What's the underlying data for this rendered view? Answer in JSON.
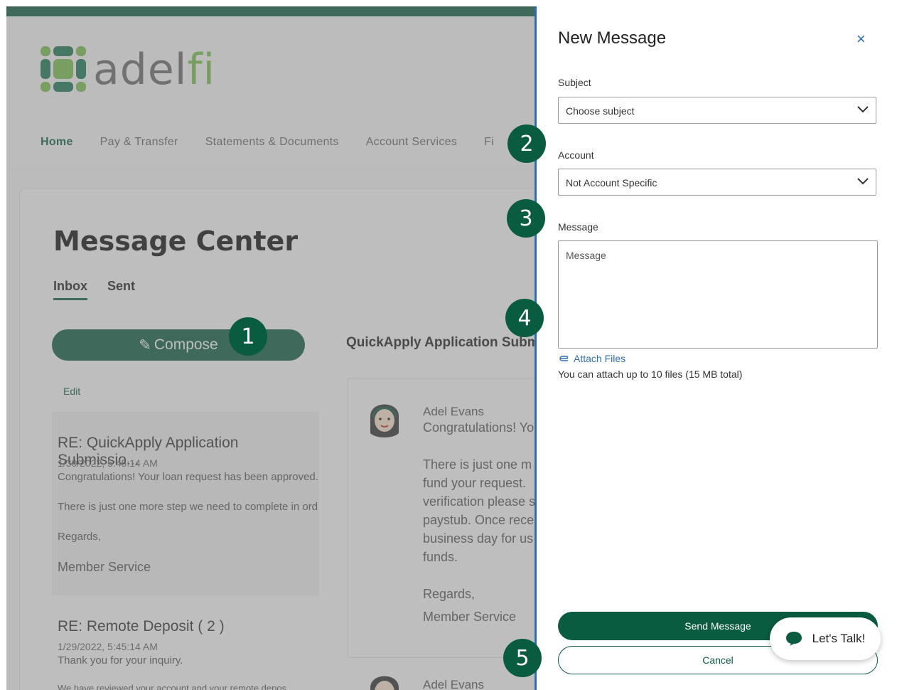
{
  "brand": {
    "logo_main": "adel",
    "logo_accent": "fi"
  },
  "nav": [
    "Home",
    "Pay & Transfer",
    "Statements & Documents",
    "Account Services",
    "Fi"
  ],
  "page": {
    "title": "Message Center",
    "tabs": [
      "Inbox",
      "Sent"
    ],
    "compose_label": "Compose",
    "edit_label": "Edit"
  },
  "messages": [
    {
      "subject": "RE: QuickApply Application Submissio...",
      "date": "1/30/2022, 5:45:14 AM",
      "lines": [
        "Congratulations! Your loan request has been approved.",
        "There is just one more step we need to complete in ord",
        "Regards,",
        "Member Service"
      ]
    },
    {
      "subject": "RE: Remote Deposit ( 2 )",
      "date": "1/29/2022, 5:45:14 AM",
      "lines": [
        "Thank you for your inquiry.",
        "We have reviewed your account and your remote depos"
      ]
    }
  ],
  "detail": {
    "title": "QuickApply Application Submi",
    "sender": "Adel Evans",
    "lines": [
      "Congratulations! Yo",
      "There is just one m",
      "fund your request.",
      "verification please s",
      "paystub. Once rece",
      "business day for us",
      "funds.",
      "Regards,",
      "Member Service"
    ],
    "sender2": "Adel Evans"
  },
  "drawer": {
    "title": "New Message",
    "close": "×",
    "subject_label": "Subject",
    "subject_value": "Choose subject",
    "account_label": "Account",
    "account_value": "Not Account Specific",
    "message_label": "Message",
    "message_placeholder": "Message",
    "attach_label": "Attach Files",
    "attach_note": "You can attach up to 10 files (15 MB total)",
    "send_label": "Send Message",
    "cancel_label": "Cancel"
  },
  "chat": {
    "label": "Let's Talk!"
  },
  "callouts": [
    "1",
    "2",
    "3",
    "4",
    "5"
  ],
  "colors": {
    "brand_green": "#0a5c41",
    "accent_blue": "#2f6fb4",
    "logo_green": "#7cc14d"
  }
}
